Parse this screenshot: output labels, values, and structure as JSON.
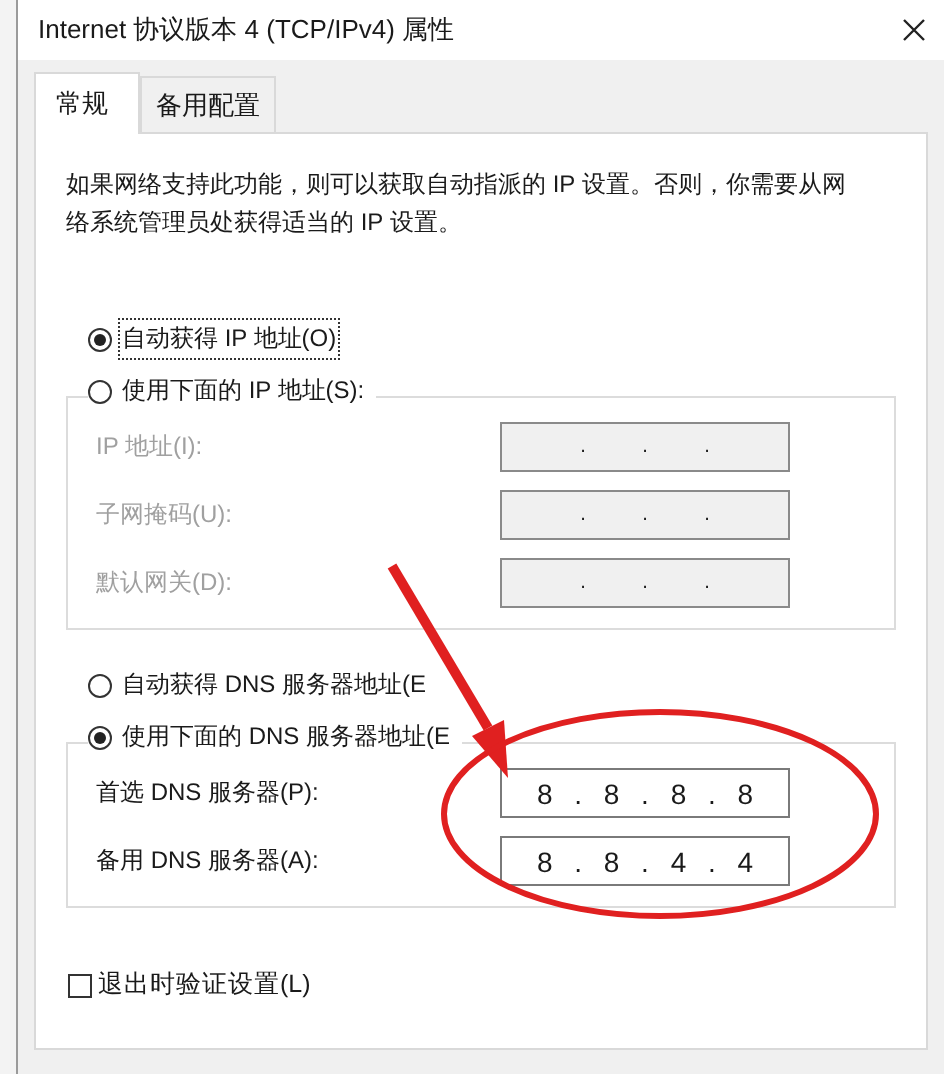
{
  "window": {
    "title": "Internet 协议版本 4 (TCP/IPv4) 属性"
  },
  "tabs": [
    {
      "label": "常规",
      "selected": true
    },
    {
      "label": "备用配置",
      "selected": false
    }
  ],
  "description": "如果网络支持此功能，则可以获取自动指派的 IP 设置。否则，你需要从网络系统管理员处获得适当的 IP 设置。",
  "ip_section": {
    "auto_option": {
      "label": "自动获得 IP 地址(O)",
      "selected": true,
      "focused": true
    },
    "manual_option": {
      "label": "使用下面的 IP 地址(S):",
      "selected": false
    },
    "fields": [
      {
        "label": "IP 地址(I):",
        "value": ". . .",
        "disabled": true
      },
      {
        "label": "子网掩码(U):",
        "value": ". . .",
        "disabled": true
      },
      {
        "label": "默认网关(D):",
        "value": ". . .",
        "disabled": true
      }
    ]
  },
  "dns_section": {
    "auto_option": {
      "label": "自动获得 DNS 服务器地址(E",
      "selected": false,
      "focused": false
    },
    "manual_option": {
      "label": "使用下面的 DNS 服务器地址(E",
      "selected": true
    },
    "fields": [
      {
        "label": "首选 DNS 服务器(P):",
        "value": "8 . 8 . 8 . 8",
        "disabled": false
      },
      {
        "label": "备用 DNS 服务器(A):",
        "value": "8 . 8 . 4 . 4",
        "disabled": false
      }
    ]
  },
  "validate_on_exit": {
    "label": "退出时验证设置(L)",
    "checked": false
  }
}
